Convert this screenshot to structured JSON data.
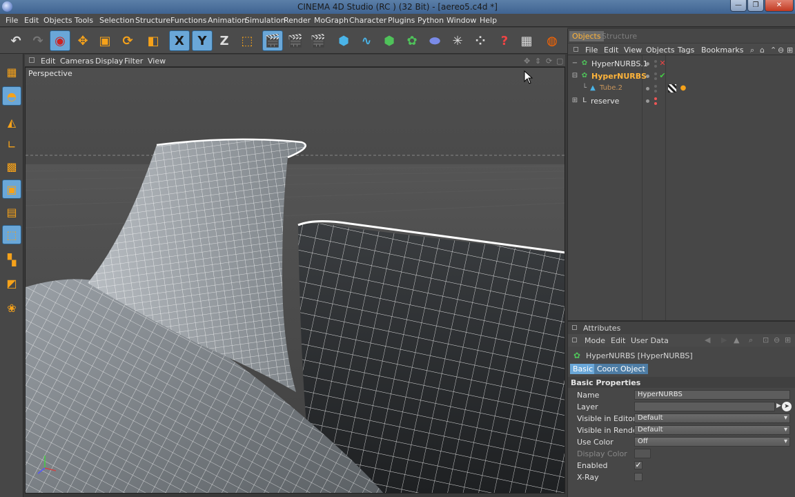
{
  "window": {
    "title": "CINEMA 4D Studio (RC ) (32 Bit) - [aereo5.c4d *]",
    "minimize": "—",
    "maximize": "❐",
    "close": "✕"
  },
  "menubar": [
    "File",
    "Edit",
    "Objects",
    "Tools",
    "Selection",
    "Structure",
    "Functions",
    "Animation",
    "Simulation",
    "Render",
    "MoGraph",
    "Character",
    "Plugins",
    "Python",
    "Window",
    "Help"
  ],
  "toolbar": {
    "x_axis": "X",
    "y_axis": "Y",
    "z_axis": "Z",
    "help": "?"
  },
  "viewport": {
    "menu": [
      "Edit",
      "Cameras",
      "Display",
      "Filter",
      "View"
    ],
    "label": "Perspective"
  },
  "object_manager": {
    "tabs": [
      "Objects",
      "Structure"
    ],
    "menu": [
      "File",
      "Edit",
      "View",
      "Objects",
      "Tags",
      "Bookmarks"
    ],
    "objects": [
      {
        "name": "HyperNURBS.1",
        "selected": false
      },
      {
        "name": "HyperNURBS",
        "selected": true
      },
      {
        "name": "Tube.2",
        "selected": false
      },
      {
        "name": "reserve",
        "selected": false
      }
    ]
  },
  "attributes": {
    "title": "Attributes",
    "menu": [
      "Mode",
      "Edit",
      "User Data"
    ],
    "object_header": "HyperNURBS [HyperNURBS]",
    "tabs": [
      "Basic",
      "Coord",
      "Object"
    ],
    "section": "Basic Properties",
    "props": [
      {
        "label": "Name",
        "value": "HyperNURBS"
      },
      {
        "label": "Layer",
        "value": ""
      },
      {
        "label": "Visible in Editor",
        "value": "Default"
      },
      {
        "label": "Visible in Renderer",
        "value": "Default"
      },
      {
        "label": "Use Color",
        "value": "Off"
      },
      {
        "label": "Display Color",
        "value": ""
      },
      {
        "label": "Enabled",
        "value": "✓"
      },
      {
        "label": "X-Ray",
        "value": ""
      }
    ]
  },
  "colors": {
    "accent": "#6aa7d8",
    "selected_object": "#ffb43a",
    "viewport_bg": "#4a4a4a"
  }
}
